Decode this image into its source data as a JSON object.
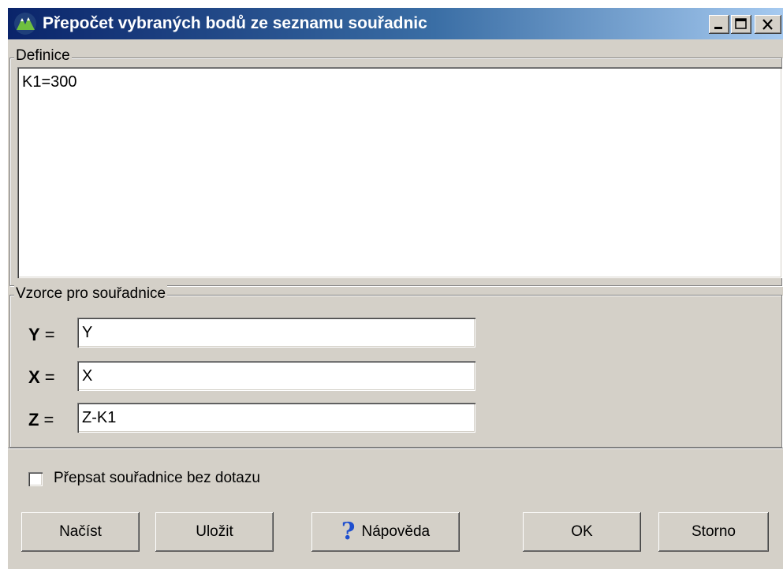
{
  "window": {
    "title": "Přepočet vybraných bodů ze seznamu souřadnic",
    "controls": {
      "minimize": "minimize",
      "maximize": "maximize",
      "close": "close"
    }
  },
  "definice": {
    "legend": "Definice",
    "text": "K1=300"
  },
  "vzorce": {
    "legend": "Vzorce pro souřadnice",
    "rows": [
      {
        "var": "Y",
        "eq": "=",
        "value": "Y"
      },
      {
        "var": "X",
        "eq": "=",
        "value": "X"
      },
      {
        "var": "Z",
        "eq": "=",
        "value": "Z-K1"
      }
    ]
  },
  "options": {
    "overwrite_label": "Přepsat souřadnice bez dotazu",
    "overwrite_checked": false
  },
  "buttons": {
    "load": "Načíst",
    "save": "Uložit",
    "help": "Nápověda",
    "help_icon": "?",
    "ok": "OK",
    "cancel": "Storno"
  },
  "colors": {
    "titlebar_start": "#0a246a",
    "titlebar_end": "#a6caf0",
    "face": "#d4d0c8"
  }
}
